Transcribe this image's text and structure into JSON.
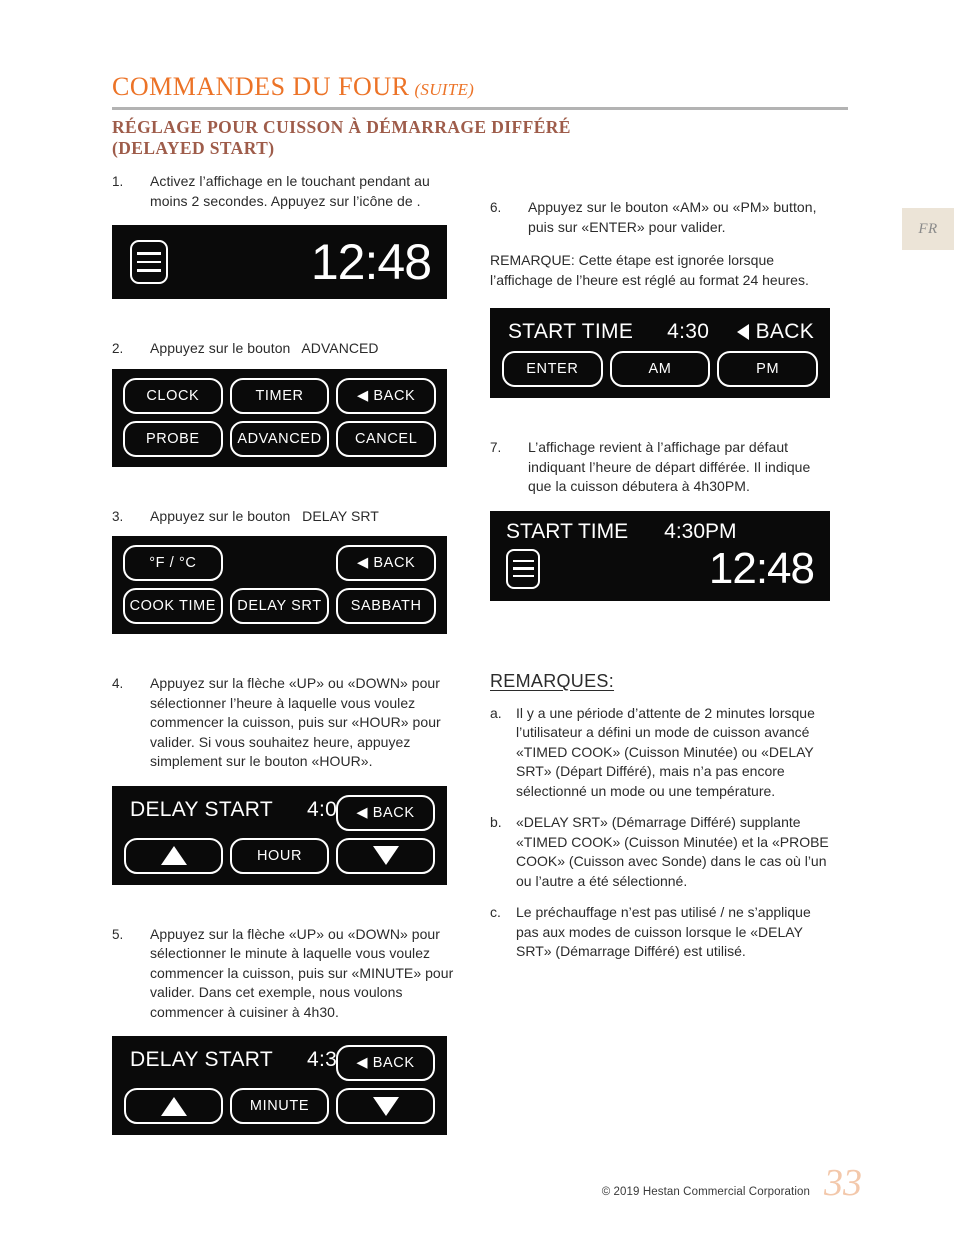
{
  "header": {
    "title": "COMMANDES DU FOUR",
    "suffix": "(SUITE)",
    "subtitle": "RÉGLAGE POUR CUISSON À DÉMARRAGE DIFFÉRÉ (DELAYED START)",
    "accent_color": "#ec7327",
    "subtitle_color": "#9e5c4a",
    "rule_color": "#b3b3b3"
  },
  "lang_tab": {
    "label": "FR",
    "bg_color": "#ece4d7",
    "text_color": "#8a8a8a"
  },
  "steps": {
    "s1": {
      "num": "1.",
      "text": "Activez l’affichage en le touchant pendant au moins 2 secondes.  Appuyez sur l’icône de        ."
    },
    "s2": {
      "num": "2.",
      "text": "Appuyez sur le bouton   ADVANCED"
    },
    "s3": {
      "num": "3.",
      "text": "Appuyez sur le bouton   DELAY SRT"
    },
    "s4": {
      "num": "4.",
      "text": "Appuyez sur la flèche «UP» ou «DOWN» pour sélectionner l’heure à laquelle vous voulez commencer la cuisson, puis sur «HOUR» pour valider.  Si vous souhaitez heure, appuyez simplement sur le bouton «HOUR»."
    },
    "s5": {
      "num": "5.",
      "text": "Appuyez sur la flèche «UP» ou «DOWN» pour sélectionner le minute à laquelle vous voulez commencer la cuisson, puis sur «MINUTE» pour valider.  Dans cet exemple, nous voulons commencer à cuisiner à 4h30."
    },
    "s6": {
      "num": "6.",
      "text": "Appuyez sur le bouton «AM» ou «PM» button, puis sur «ENTER» pour valider.",
      "note": "REMARQUE: Cette étape est ignorée lorsque l’affichage de l’heure est réglé au format 24 heures."
    },
    "s7": {
      "num": "7.",
      "text": "L’affichage revient à l’affichage par défaut indiquant l’heure de départ différée.  Il indique que la cuisson débutera à 4h30PM."
    }
  },
  "displays": {
    "clock_default": {
      "icon": "menu-icon",
      "time": "12:48"
    },
    "menu_advanced": {
      "buttons": [
        "CLOCK",
        "TIMER",
        "◀ BACK",
        "PROBE",
        "ADVANCED",
        "CANCEL"
      ]
    },
    "menu_delay": {
      "buttons": [
        "°F / °C",
        "",
        "◀ BACK",
        "COOK TIME",
        "DELAY SRT",
        "SABBATH"
      ]
    },
    "delay_hour": {
      "label": "DELAY START",
      "value": "4:00",
      "back": "◀ BACK",
      "buttons": [
        "▲",
        "HOUR",
        "▼"
      ]
    },
    "delay_minute": {
      "label": "DELAY START",
      "value": "4:30",
      "back": "◀ BACK",
      "buttons": [
        "▲",
        "MINUTE",
        "▼"
      ]
    },
    "start_time_ampm": {
      "label": "START TIME",
      "value": "4:30",
      "back": "BACK",
      "buttons": [
        "ENTER",
        "AM",
        "PM"
      ]
    },
    "start_time_final": {
      "label": "START TIME",
      "value": "4:30PM",
      "icon": "menu-icon",
      "time": "12:48"
    }
  },
  "remarques": {
    "title": "REMARQUES:",
    "items": [
      {
        "letter": "a.",
        "text": "Il y a une période d’attente de 2 minutes lorsque l’utilisateur a défini un mode de cuisson avancé «TIMED COOK» (Cuisson Minutée) ou «DELAY SRT» (Départ Différé), mais n’a pas encore sélectionné un mode ou une température."
      },
      {
        "letter": "b.",
        "text": "«DELAY SRT» (Démarrage Différé) supplante «TIMED COOK» (Cuisson Minutée) et la «PROBE COOK» (Cuisson avec Sonde) dans le cas où l’un ou l’autre a été sélectionné."
      },
      {
        "letter": "c.",
        "text": "Le préchauffage n’est pas utilisé / ne s’applique pas aux modes de cuisson lorsque le «DELAY SRT» (Démarrage Différé) est utilisé."
      }
    ]
  },
  "footer": {
    "copyright": "© 2019 Hestan Commercial Corporation",
    "page_number": "33",
    "page_number_color": "#f3c8ab"
  }
}
